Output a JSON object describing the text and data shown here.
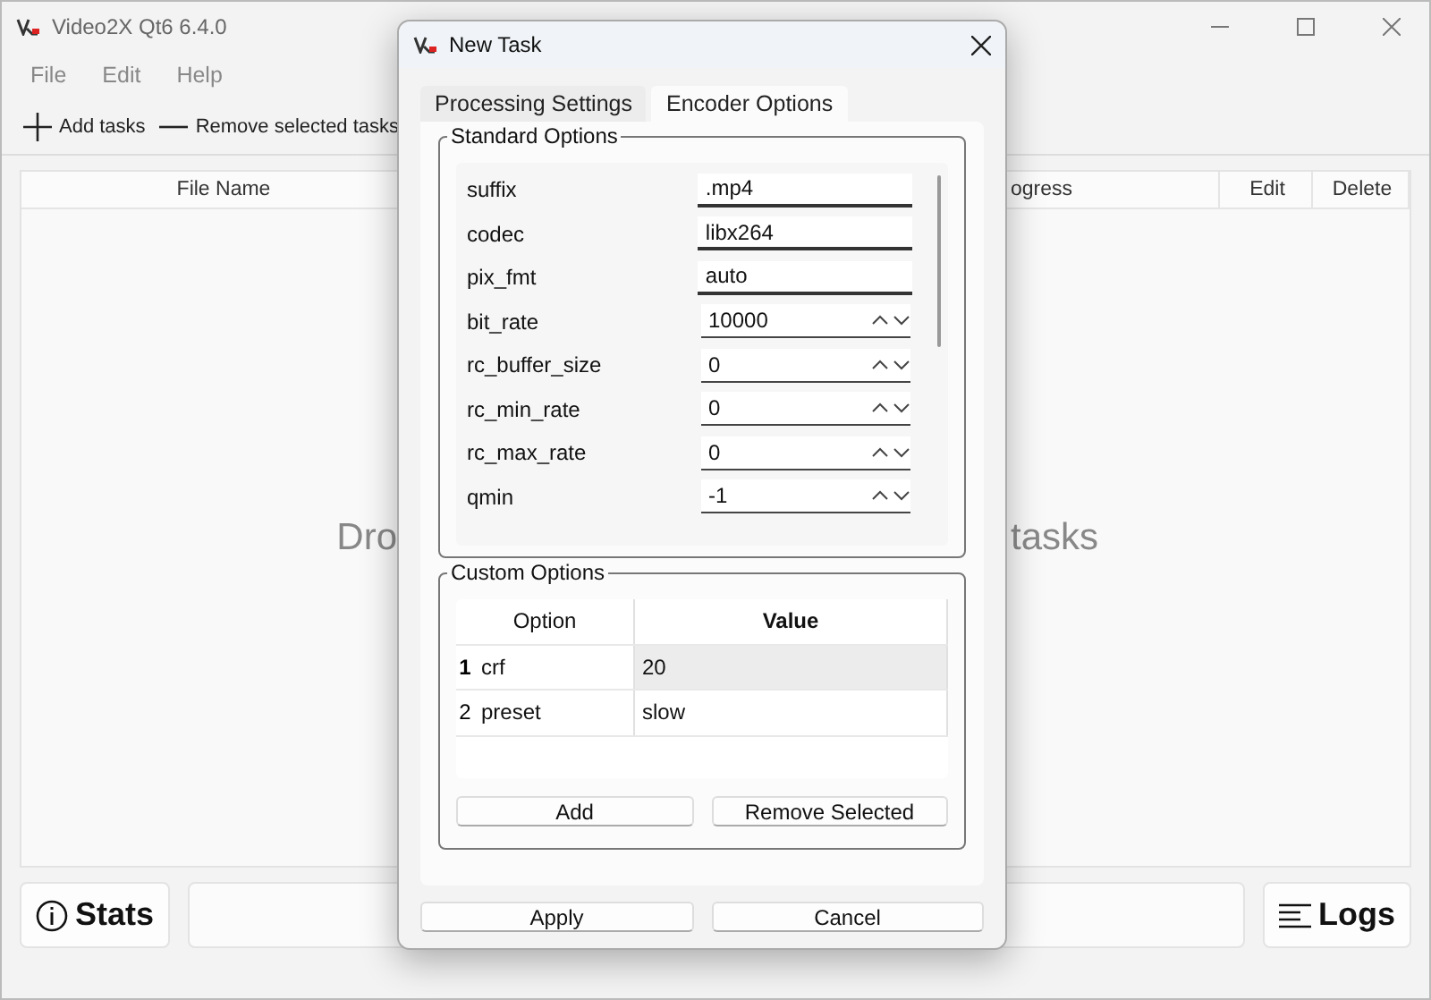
{
  "window": {
    "title": "Video2X Qt6 6.4.0"
  },
  "menu": [
    "File",
    "Edit",
    "Help"
  ],
  "toolbar": [
    "Add tasks",
    "Remove selected tasks"
  ],
  "table": {
    "columns": [
      "File Name",
      "ogress",
      "Edit",
      "Delete"
    ],
    "empty_text_left": "Dro",
    "empty_text_right": "tasks"
  },
  "bottom": {
    "stats": "Stats",
    "logs": "Logs"
  },
  "dialog": {
    "title": "New Task",
    "tabs": [
      {
        "label": "Processing Settings",
        "selected": false
      },
      {
        "label": "Encoder Options",
        "selected": true
      }
    ],
    "standard_options": {
      "title": "Standard Options",
      "rows": [
        {
          "name": "suffix",
          "kind": "text",
          "value": ".mp4"
        },
        {
          "name": "codec",
          "kind": "text",
          "value": "libx264"
        },
        {
          "name": "pix_fmt",
          "kind": "text",
          "value": "auto"
        },
        {
          "name": "bit_rate",
          "kind": "spin",
          "value": "10000"
        },
        {
          "name": "rc_buffer_size",
          "kind": "spin",
          "value": "0"
        },
        {
          "name": "rc_min_rate",
          "kind": "spin",
          "value": "0"
        },
        {
          "name": "rc_max_rate",
          "kind": "spin",
          "value": "0"
        },
        {
          "name": "qmin",
          "kind": "spin",
          "value": "-1"
        }
      ]
    },
    "custom_options": {
      "title": "Custom Options",
      "columns": [
        "Option",
        "Value"
      ],
      "rows": [
        {
          "number": "1",
          "option": "crf",
          "value": "20",
          "selected": true
        },
        {
          "number": "2",
          "option": "preset",
          "value": "slow",
          "selected": false
        }
      ],
      "buttons": [
        "Add",
        "Remove Selected"
      ]
    },
    "buttons": [
      "Apply",
      "Cancel"
    ]
  }
}
